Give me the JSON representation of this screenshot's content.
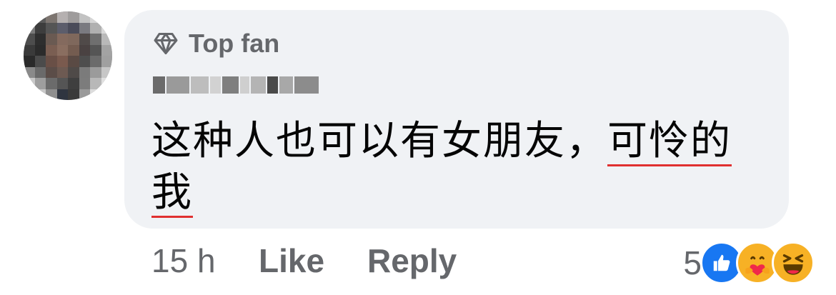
{
  "badge": {
    "label": "Top fan",
    "icon": "diamond-icon"
  },
  "comment": {
    "text_main": "这种人也可以有女朋友，",
    "text_underlined_1": "可怜的",
    "text_underlined_2": "我"
  },
  "meta": {
    "time": "15 h",
    "like_label": "Like",
    "reply_label": "Reply"
  },
  "reactions": {
    "count": "5",
    "icons": [
      "like-reaction-icon",
      "care-reaction-icon",
      "haha-reaction-icon"
    ],
    "colors": {
      "like": "#1877f2",
      "care": "#f7b125",
      "haha": "#f7b125"
    }
  }
}
